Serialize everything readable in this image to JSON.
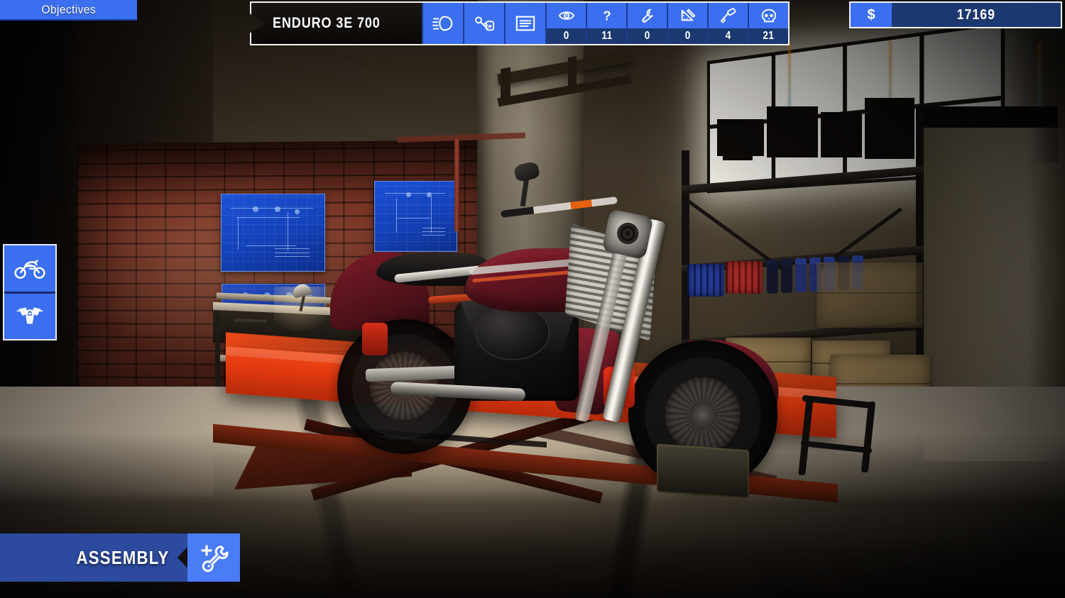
{
  "objectives": {
    "label": "Objectives"
  },
  "vehicle_hud": {
    "name": "ENDURO 3E 700",
    "tools": [
      {
        "icon": "headlight-icon",
        "name": "headlight"
      },
      {
        "icon": "keys-icon",
        "name": "keys"
      },
      {
        "icon": "order-list-icon",
        "name": "order-list"
      }
    ],
    "counters": [
      {
        "icon": "eye-icon",
        "name": "inspect",
        "value": "0"
      },
      {
        "icon": "question-icon",
        "name": "unknown",
        "value": "11"
      },
      {
        "icon": "wrench-icon",
        "name": "repair",
        "value": "0"
      },
      {
        "icon": "ruler-icon",
        "name": "measure",
        "value": "0"
      },
      {
        "icon": "paint-roller-icon",
        "name": "paint",
        "value": "4"
      },
      {
        "icon": "skull-icon",
        "name": "damaged",
        "value": "21"
      }
    ]
  },
  "money": {
    "currency": "$",
    "amount": "17169"
  },
  "sidebar": {
    "items": [
      {
        "icon": "motorcycle-icon",
        "name": "motorcycle-view"
      },
      {
        "icon": "engine-icon",
        "name": "engine-view"
      }
    ]
  },
  "assembly": {
    "label": "ASSEMBLY",
    "icon": "wrench-plus-icon"
  },
  "colors": {
    "accent_blue": "#3b6ff0",
    "accent_blue_light": "#4a7cf5",
    "accent_blue_dark": "#1c3870",
    "panel_dark": "#2c4a9e",
    "hud_text": "#ffffff",
    "lift_red": "#e2390f",
    "bike_red": "#5f1420"
  }
}
